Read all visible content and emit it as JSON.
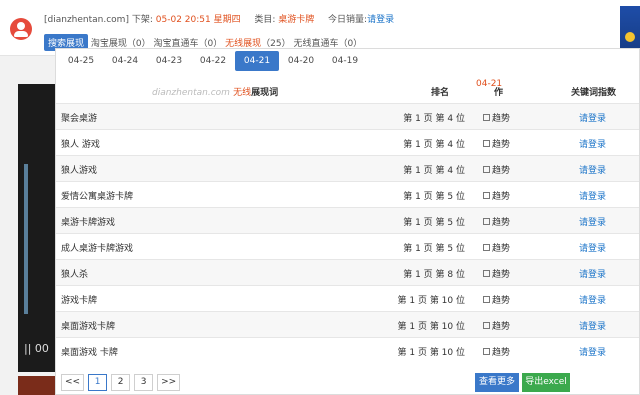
{
  "header": {
    "site": "[dianzhentan.com]",
    "delist_label": "下架:",
    "delist_time": "05-02 20:51",
    "weekday": "星期四",
    "category_label": "类目:",
    "category_value": "桌游卡牌",
    "sales_label": "今日销量:",
    "sales_value": "请登录"
  },
  "filters": {
    "selected": "搜索展现",
    "taobao_show": "淘宝展现（0）",
    "taobao_direct": "淘宝直通车（0）",
    "wireless_show": "无线展现",
    "wireless_count": "（25）",
    "wireless_direct": "无线直通车（0）"
  },
  "date_tabs": [
    "04-25",
    "04-24",
    "04-23",
    "04-22",
    "04-21",
    "04-20",
    "04-19"
  ],
  "active_date": "04-21",
  "table": {
    "watermark": "dianzhentan.com",
    "kw_header_red": "无线",
    "kw_header_rest": "展现词",
    "rank_header": "排名",
    "date_header": "04-21",
    "op_header": "作",
    "index_header": "关键词指数",
    "rows": [
      {
        "keyword": "聚会桌游",
        "rank": "第 1 页 第 4 位",
        "trend": "趋势",
        "index": "请登录"
      },
      {
        "keyword": "狼人 游戏",
        "rank": "第 1 页 第 4 位",
        "trend": "趋势",
        "index": "请登录"
      },
      {
        "keyword": "狼人游戏",
        "rank": "第 1 页 第 4 位",
        "trend": "趋势",
        "index": "请登录"
      },
      {
        "keyword": "爱情公寓桌游卡牌",
        "rank": "第 1 页 第 5 位",
        "trend": "趋势",
        "index": "请登录"
      },
      {
        "keyword": "桌游卡牌游戏",
        "rank": "第 1 页 第 5 位",
        "trend": "趋势",
        "index": "请登录"
      },
      {
        "keyword": "成人桌游卡牌游戏",
        "rank": "第 1 页 第 5 位",
        "trend": "趋势",
        "index": "请登录"
      },
      {
        "keyword": "狼人杀",
        "rank": "第 1 页 第 8 位",
        "trend": "趋势",
        "index": "请登录"
      },
      {
        "keyword": "游戏卡牌",
        "rank": "第 1 页 第 10 位",
        "trend": "趋势",
        "index": "请登录"
      },
      {
        "keyword": "桌面游戏卡牌",
        "rank": "第 1 页 第 10 位",
        "trend": "趋势",
        "index": "请登录"
      },
      {
        "keyword": "桌面游戏 卡牌",
        "rank": "第 1 页 第 10 位",
        "trend": "趋势",
        "index": "请登录"
      }
    ]
  },
  "pager": {
    "first": "<<",
    "pages": [
      "1",
      "2",
      "3"
    ],
    "last": ">>",
    "current": "1"
  },
  "actions": {
    "more": "查看更多",
    "excel": "导出excel"
  },
  "video": {
    "control": "|| 00"
  },
  "colors": {
    "accent": "#3a78c9",
    "highlight": "#e0501e",
    "excel": "#3ba94d"
  }
}
